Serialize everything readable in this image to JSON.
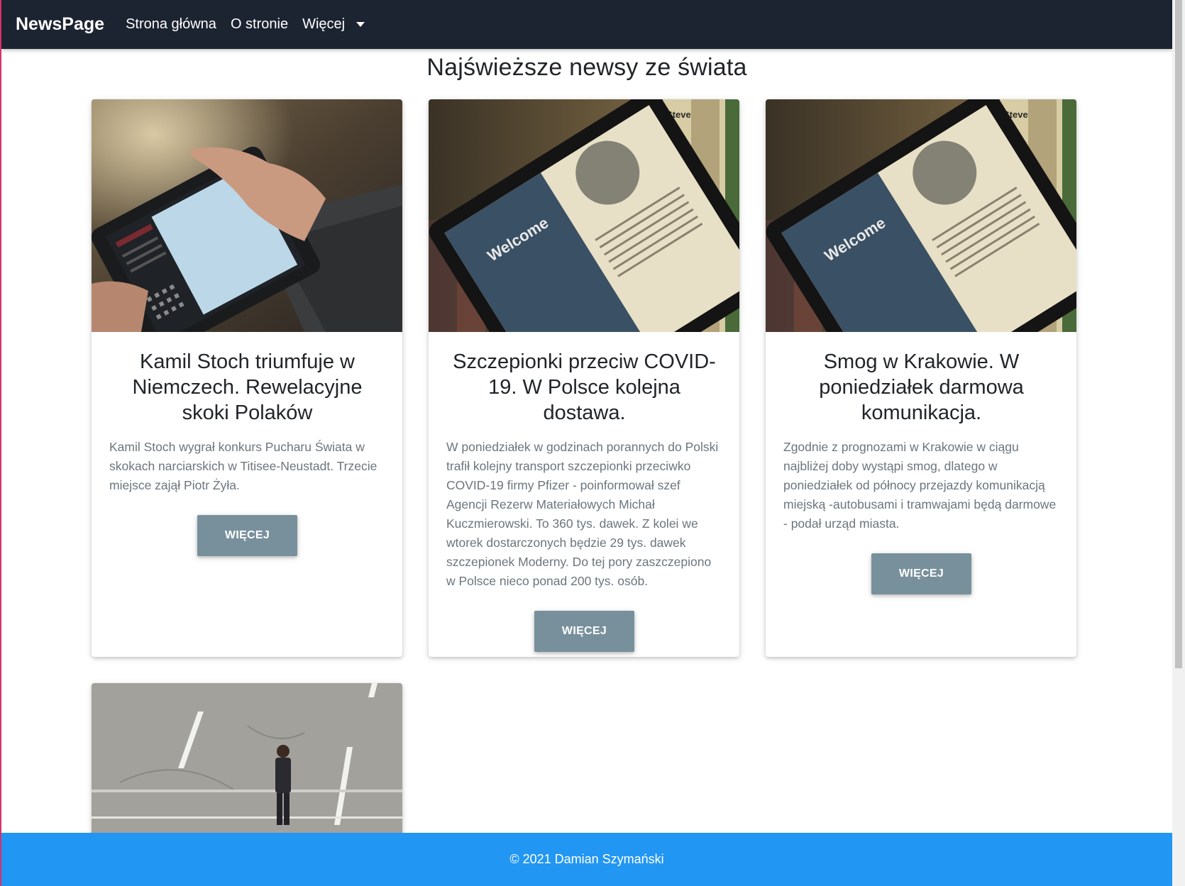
{
  "navbar": {
    "brand": "NewsPage",
    "links": [
      {
        "label": "Strona główna"
      },
      {
        "label": "O stronie"
      },
      {
        "label": "Więcej"
      }
    ]
  },
  "page": {
    "title": "Najświeższe newsy ze świata"
  },
  "articles": [
    {
      "title": "Kamil Stoch triumfuje w Niemczech. Rewelacyjne skoki Polaków",
      "text": "Kamil Stoch wygrał konkurs Pucharu Świata w skokach narciarskich w Titisee-Neustadt. Trzecie miejsce zajął Piotr Żyła.",
      "button": "WIĘCEJ"
    },
    {
      "title": "Szczepionki przeciw COVID-19. W Polsce kolejna dostawa.",
      "text": "W poniedziałek w godzinach porannych do Polski trafił kolejny transport szczepionki przeciwko COVID-19 firmy Pfizer - poinformował szef Agencji Rezerw Materiałowych Michał Kuczmierowski. To 360 tys. dawek. Z kolei we wtorek dostarczonych będzie 29 tys. dawek szczepionek Moderny. Do tej pory zaszczepiono w Polsce nieco ponad 200 tys. osób.",
      "button": "WIĘCEJ"
    },
    {
      "title": "Smog w Krakowie. W poniedziałek darmowa komunikacja.",
      "text": "Zgodnie z prognozami w Krakowie w ciągu najbliżej doby wystąpi smog, dlatego w poniedziałek od północy przejazdy komunikacją miejską -autobusami i tramwajami będą darmowe - podał urząd miasta.",
      "button": "WIĘCEJ"
    }
  ],
  "images": {
    "tablet_screen_text": "Welcome",
    "book_label": "Steve"
  },
  "footer": {
    "text": "© 2021 Damian Szymański"
  },
  "colors": {
    "navbar": "#1c2331",
    "footer": "#2196f3",
    "button": "#78909c"
  }
}
